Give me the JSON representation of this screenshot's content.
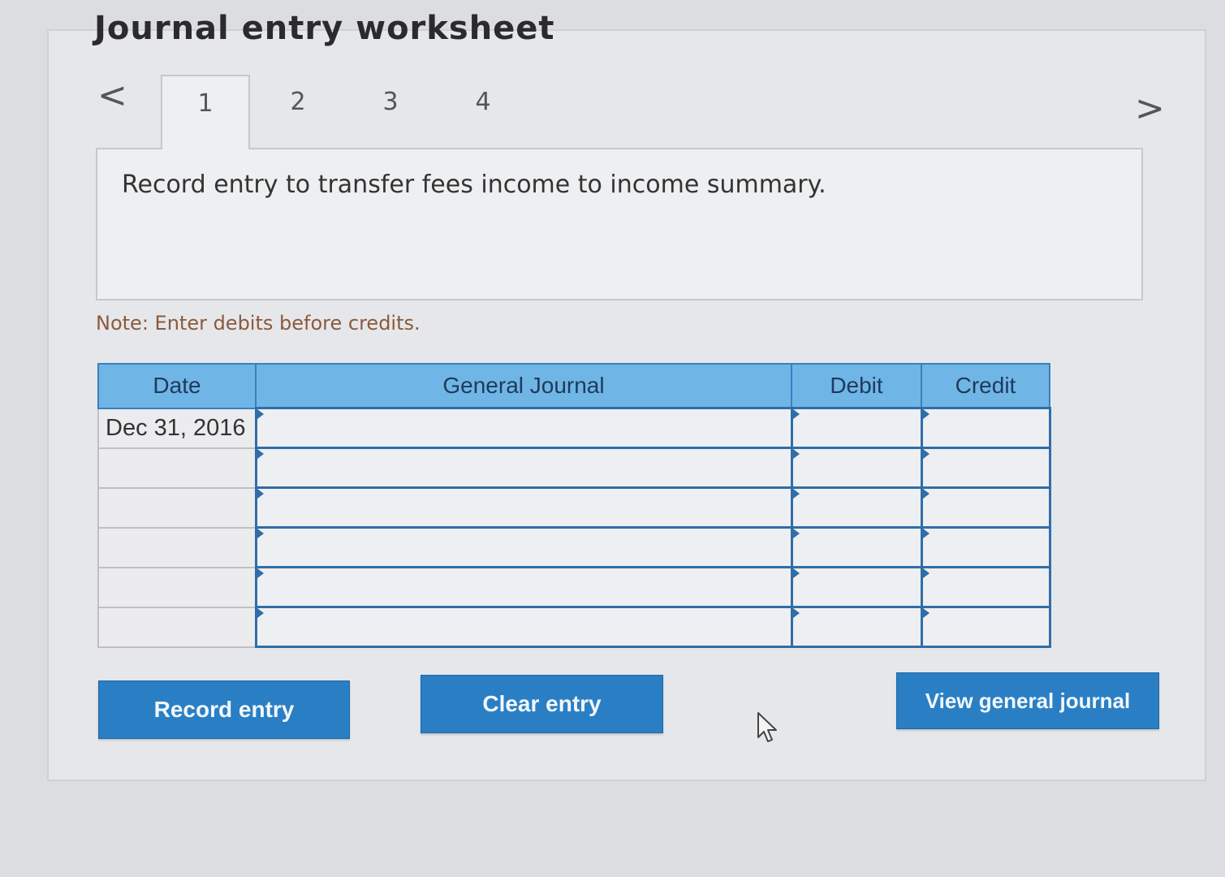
{
  "header": {
    "title": "Journal entry worksheet"
  },
  "navigation": {
    "prev_icon": "<",
    "next_icon": ">",
    "tabs": [
      {
        "label": "1",
        "active": true
      },
      {
        "label": "2",
        "active": false
      },
      {
        "label": "3",
        "active": false
      },
      {
        "label": "4",
        "active": false
      }
    ]
  },
  "instruction": {
    "text": "Record entry to transfer fees income to income summary."
  },
  "note": {
    "text": "Note: Enter debits before credits."
  },
  "journal": {
    "columns": [
      "Date",
      "General Journal",
      "Debit",
      "Credit"
    ],
    "rows": [
      {
        "date": "Dec 31, 2016",
        "account": "",
        "debit": "",
        "credit": ""
      },
      {
        "date": "",
        "account": "",
        "debit": "",
        "credit": ""
      },
      {
        "date": "",
        "account": "",
        "debit": "",
        "credit": ""
      },
      {
        "date": "",
        "account": "",
        "debit": "",
        "credit": ""
      },
      {
        "date": "",
        "account": "",
        "debit": "",
        "credit": ""
      },
      {
        "date": "",
        "account": "",
        "debit": "",
        "credit": ""
      }
    ]
  },
  "buttons": {
    "record_label": "Record entry",
    "clear_label": "Clear entry",
    "view_label": "View general journal"
  },
  "colors": {
    "accent": "#2a7fc4",
    "header_blue": "#6fb6e6",
    "note_brown": "#8b5a3c"
  },
  "icons": {
    "cursor": "mouse-pointer-icon"
  }
}
